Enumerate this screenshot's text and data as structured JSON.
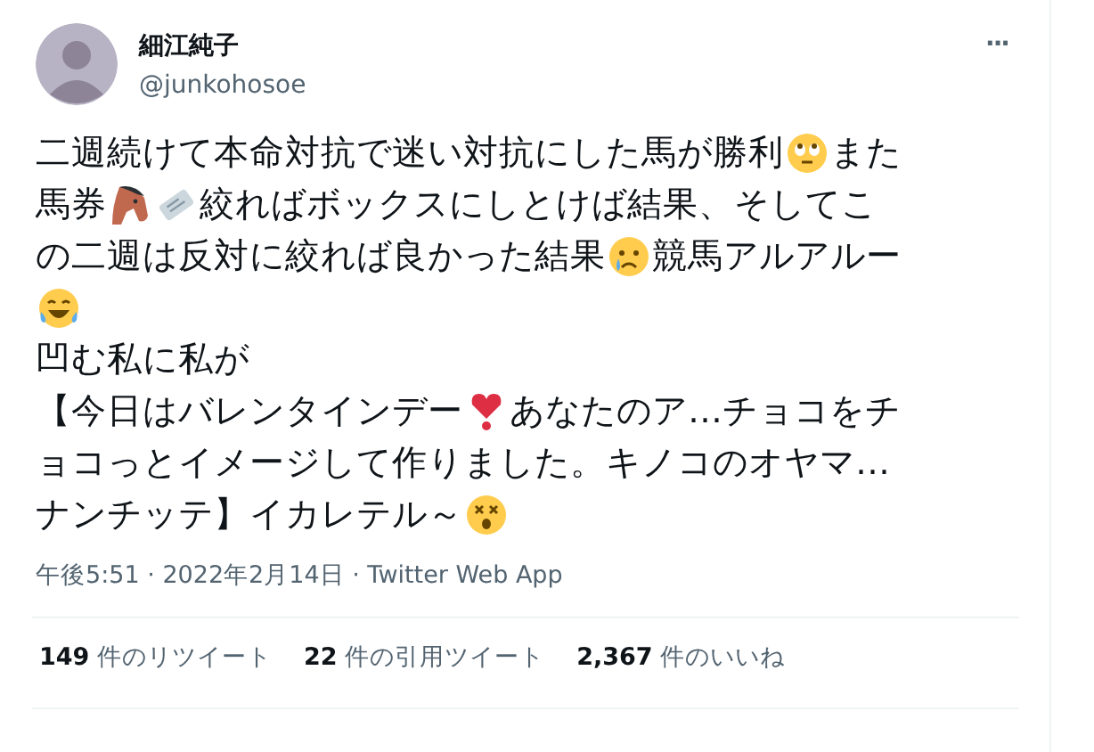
{
  "author": {
    "name": "細江純子",
    "handle": "@junkohosoe"
  },
  "more_button": "···",
  "body_lines": [
    [
      {
        "kind": "text",
        "text": "二週続けて本命対抗で迷い対抗にした馬が勝利"
      },
      {
        "kind": "eyes-face"
      },
      {
        "kind": "text",
        "text": "また"
      }
    ],
    [
      {
        "kind": "text",
        "text": "馬券"
      },
      {
        "kind": "horse"
      },
      {
        "kind": "ticket"
      },
      {
        "kind": "text",
        "text": "絞ればボックスにしとけば結果、そしてこ"
      }
    ],
    [
      {
        "kind": "text",
        "text": "の二週は反対に絞れば良かった結果"
      },
      {
        "kind": "crying-face"
      },
      {
        "kind": "text",
        "text": "競馬アルアルー"
      }
    ],
    [
      {
        "kind": "laughing-face"
      }
    ],
    [
      {
        "kind": "text",
        "text": "凹む私に私が"
      }
    ],
    [
      {
        "kind": "text",
        "text": "【今日はバレンタインデー"
      },
      {
        "kind": "heart"
      },
      {
        "kind": "text",
        "text": "あなたのア…チョコをチ"
      }
    ],
    [
      {
        "kind": "text",
        "text": "ョコっとイメージして作りました。キノコのオヤマ…"
      }
    ],
    [
      {
        "kind": "text",
        "text": "ナンチッテ】イカレテル～"
      },
      {
        "kind": "dizzy-face"
      }
    ]
  ],
  "timestamp": "午後5:51 · 2022年2月14日 · Twitter Web App",
  "stats": [
    "**149** 件のリツイート",
    "**22** 件の引用ツイート",
    "**2,367** 件のいいね"
  ]
}
